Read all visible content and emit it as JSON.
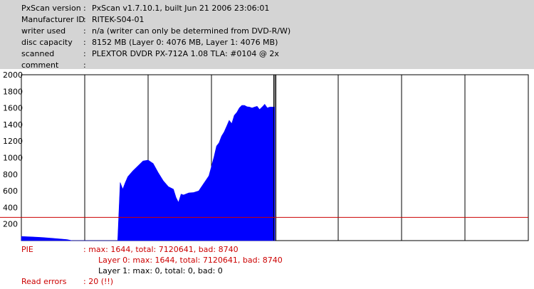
{
  "info": [
    {
      "label": "PxScan version",
      "value": "PxScan v1.7.10.1, built Jun 21 2006 23:06:01"
    },
    {
      "label": "Manufacturer ID",
      "value": "RITEK-S04-01"
    },
    {
      "label": "writer used",
      "value": "n/a (writer can only be determined from DVD-R/W)"
    },
    {
      "label": "disc capacity",
      "value": "8152 MB (Layer 0: 4076 MB,  Layer 1: 4076 MB)"
    },
    {
      "label": "scanned",
      "value": "PLEXTOR DVDR PX-712A 1.08 TLA: #0104 @ 2x"
    },
    {
      "label": "comment",
      "value": ""
    }
  ],
  "separator": ":",
  "colors": {
    "panel_bg": "#d4d4d4",
    "bars": "#0000ff",
    "threshold": "#cc0000",
    "grid": "#000000",
    "text_red": "#cc0000"
  },
  "chart_data": {
    "type": "area",
    "ylim": [
      0,
      2000
    ],
    "yticks": [
      "2000",
      "1800",
      "1600",
      "1400",
      "1200",
      "1000",
      "800",
      "600",
      "400",
      "200"
    ],
    "xlim": [
      0,
      100
    ],
    "threshold": 280,
    "layer_break": 50,
    "grid": true,
    "x": [
      0,
      2,
      4,
      6,
      8,
      9,
      9.5,
      10,
      12,
      16,
      19,
      19.5,
      20,
      20.5,
      21,
      22,
      23,
      24,
      25,
      26,
      27,
      28,
      29,
      30,
      30.5,
      31,
      31.5,
      32,
      33,
      34,
      35,
      36,
      37,
      38,
      38.5,
      39,
      39.5,
      40,
      40.5,
      41,
      41.5,
      42,
      42.5,
      43,
      43.5,
      44,
      44.5,
      45,
      45.5,
      46,
      46.5,
      47,
      47.5,
      48,
      48.5,
      49,
      50
    ],
    "values": [
      50,
      45,
      38,
      28,
      18,
      12,
      6,
      0,
      0,
      0,
      0,
      700,
      620,
      700,
      770,
      840,
      900,
      960,
      970,
      930,
      820,
      720,
      650,
      620,
      520,
      460,
      560,
      550,
      575,
      580,
      600,
      690,
      780,
      1010,
      1140,
      1180,
      1260,
      1310,
      1380,
      1450,
      1410,
      1510,
      1545,
      1600,
      1630,
      1630,
      1615,
      1610,
      1600,
      1610,
      1620,
      1580,
      1610,
      1644,
      1600,
      1610,
      1610
    ]
  },
  "results": {
    "pie_label": "PIE",
    "pie_line": ": max: 1644, total: 7120641, bad: 8740",
    "layer0_line": "Layer 0: max: 1644, total: 7120641, bad: 8740",
    "layer1_line": "Layer 1: max: 0, total: 0, bad: 0",
    "read_errors_label": "Read errors",
    "read_errors_line": ": 20 (!!)"
  }
}
